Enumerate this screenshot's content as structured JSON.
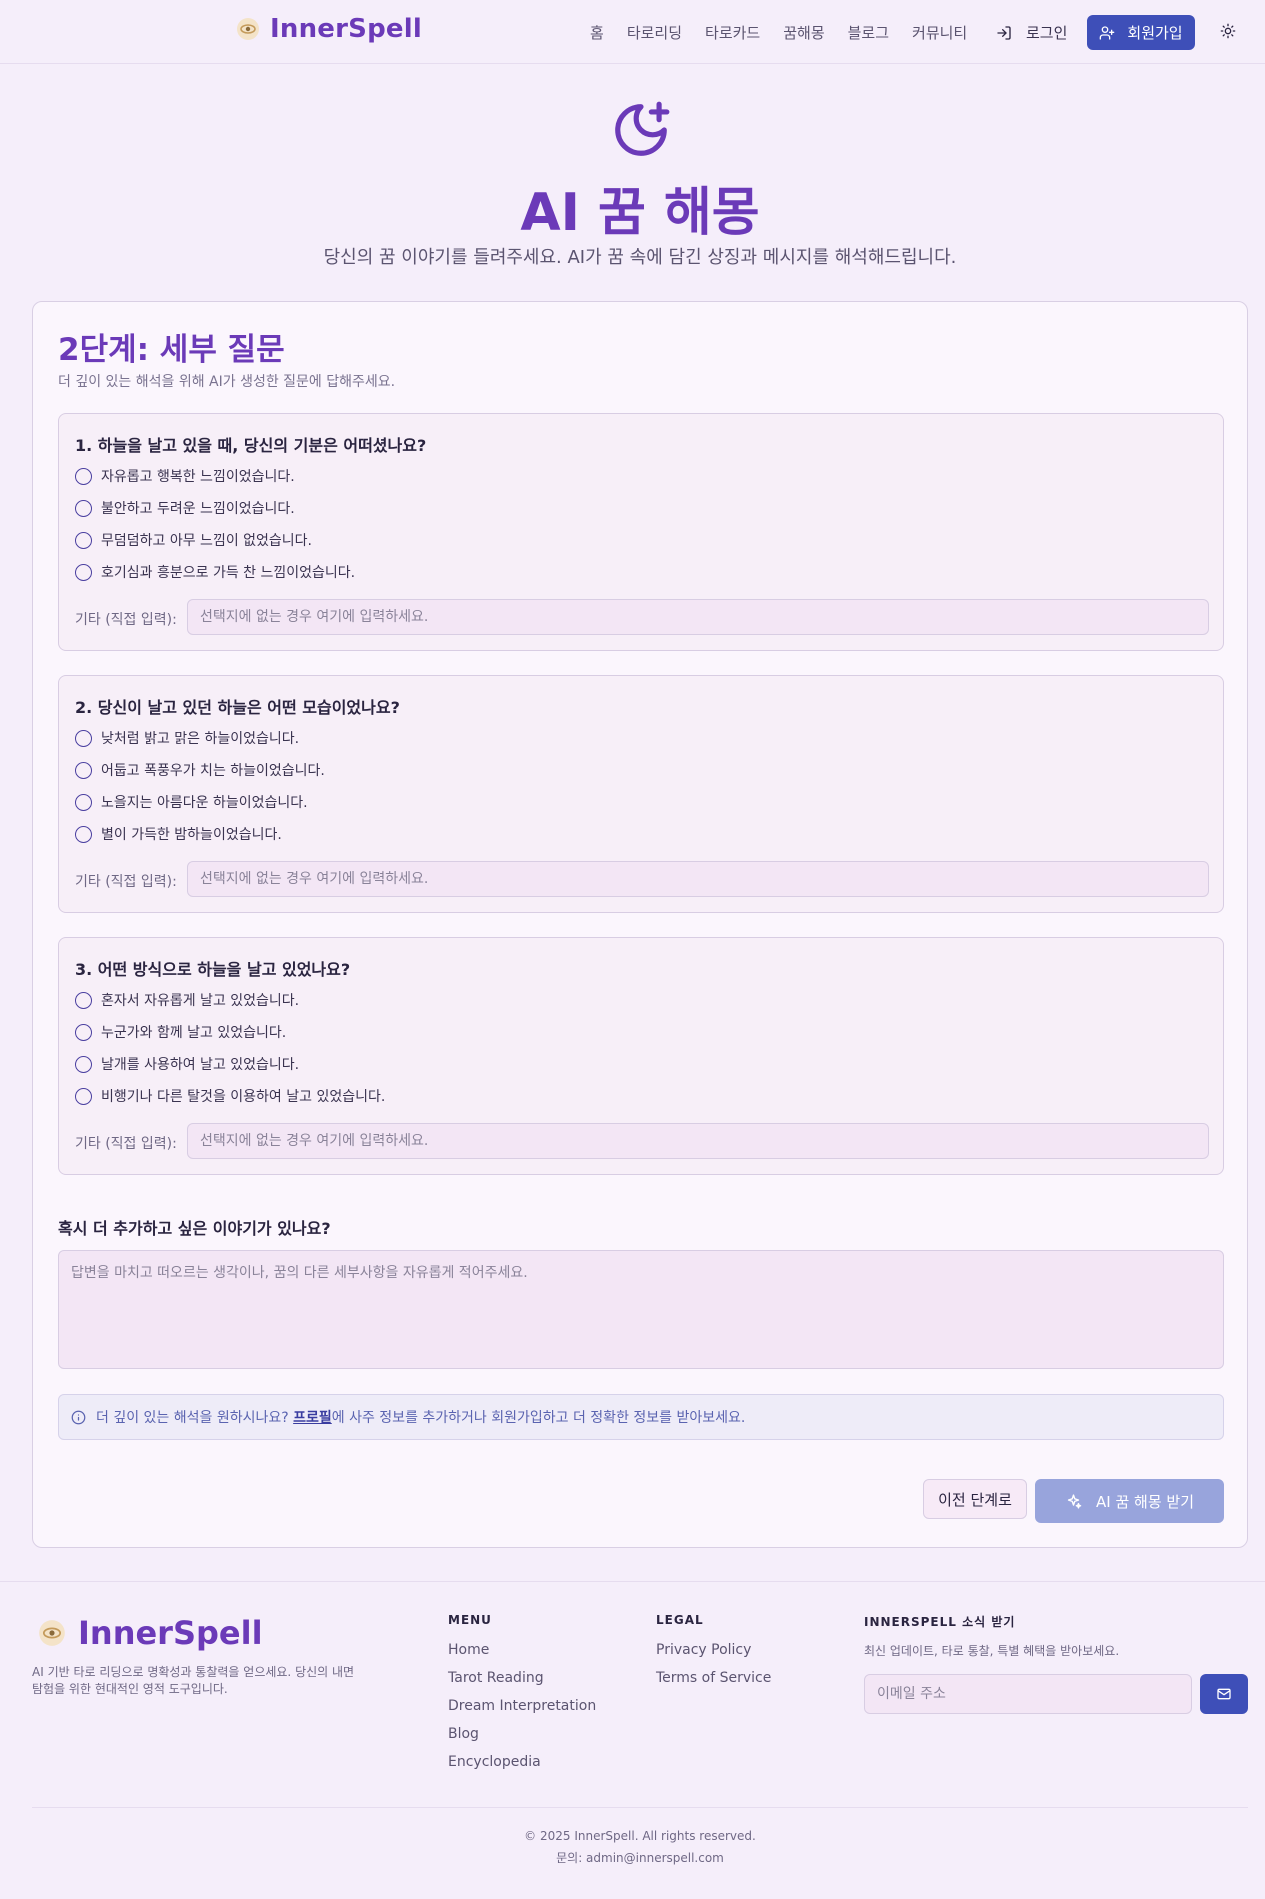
{
  "header": {
    "brand": "InnerSpell",
    "nav": [
      "홈",
      "타로리딩",
      "타로카드",
      "꿈해몽",
      "블로그",
      "커뮤니티"
    ],
    "login": "로그인",
    "signup": "회원가입"
  },
  "hero": {
    "title": "AI 꿈 해몽",
    "subtitle": "당신의 꿈 이야기를 들려주세요. AI가 꿈 속에 담긴 상징과 메시지를 해석해드립니다."
  },
  "step": {
    "title": "2단계: 세부 질문",
    "description": "더 깊이 있는 해석을 위해 AI가 생성한 질문에 답해주세요."
  },
  "questions": [
    {
      "title": "1. 하늘을 날고 있을 때, 당신의 기분은 어떠셨나요?",
      "options": [
        "자유롭고 행복한 느낌이었습니다.",
        "불안하고 두려운 느낌이었습니다.",
        "무덤덤하고 아무 느낌이 없었습니다.",
        "호기심과 흥분으로 가득 찬 느낌이었습니다."
      ],
      "other_label": "기타 (직접 입력):",
      "other_placeholder": "선택지에 없는 경우 여기에 입력하세요."
    },
    {
      "title": "2. 당신이 날고 있던 하늘은 어떤 모습이었나요?",
      "options": [
        "낮처럼 밝고 맑은 하늘이었습니다.",
        "어둡고 폭풍우가 치는 하늘이었습니다.",
        "노을지는 아름다운 하늘이었습니다.",
        "별이 가득한 밤하늘이었습니다."
      ],
      "other_label": "기타 (직접 입력):",
      "other_placeholder": "선택지에 없는 경우 여기에 입력하세요."
    },
    {
      "title": "3. 어떤 방식으로 하늘을 날고 있었나요?",
      "options": [
        "혼자서 자유롭게 날고 있었습니다.",
        "누군가와 함께 날고 있었습니다.",
        "날개를 사용하여 날고 있었습니다.",
        "비행기나 다른 탈것을 이용하여 날고 있었습니다."
      ],
      "other_label": "기타 (직접 입력):",
      "other_placeholder": "선택지에 없는 경우 여기에 입력하세요."
    }
  ],
  "extra": {
    "title": "혹시 더 추가하고 싶은 이야기가 있나요?",
    "placeholder": "답변을 마치고 떠오르는 생각이나, 꿈의 다른 세부사항을 자유롭게 적어주세요."
  },
  "info": {
    "prefix": "더 깊이 있는 해석을 원하시나요?",
    "link": "프로필",
    "suffix": "에 사주 정보를 추가하거나 회원가입하고 더 정확한 정보를 받아보세요."
  },
  "buttons": {
    "prev": "이전 단계로",
    "submit": "AI 꿈 해몽 받기"
  },
  "footer": {
    "brand": "InnerSpell",
    "description": "AI 기반 타로 리딩으로 명확성과 통찰력을 얻으세요. 당신의 내면 탐험을 위한 현대적인 영적 도구입니다.",
    "menu_title": "MENU",
    "menu": [
      "Home",
      "Tarot Reading",
      "Dream Interpretation",
      "Blog",
      "Encyclopedia"
    ],
    "legal_title": "LEGAL",
    "legal": [
      "Privacy Policy",
      "Terms of Service"
    ],
    "news_title": "INNERSPELL 소식 받기",
    "news_desc": "최신 업데이트, 타로 통찰, 특별 혜택을 받아보세요.",
    "email_placeholder": "이메일 주소",
    "copyright": "© 2025 InnerSpell. All rights reserved.",
    "contact": "문의: admin@innerspell.com"
  },
  "colors": {
    "accent": "#6b3ab8",
    "primary_button": "#3e4fb8",
    "disabled_button": "#98a4dc",
    "background": "#f5eefa"
  },
  "icons": [
    "eye-logo-icon",
    "login-icon",
    "user-plus-icon",
    "sun-icon",
    "moon-star-icon",
    "info-icon",
    "sparkles-icon",
    "mail-icon"
  ]
}
